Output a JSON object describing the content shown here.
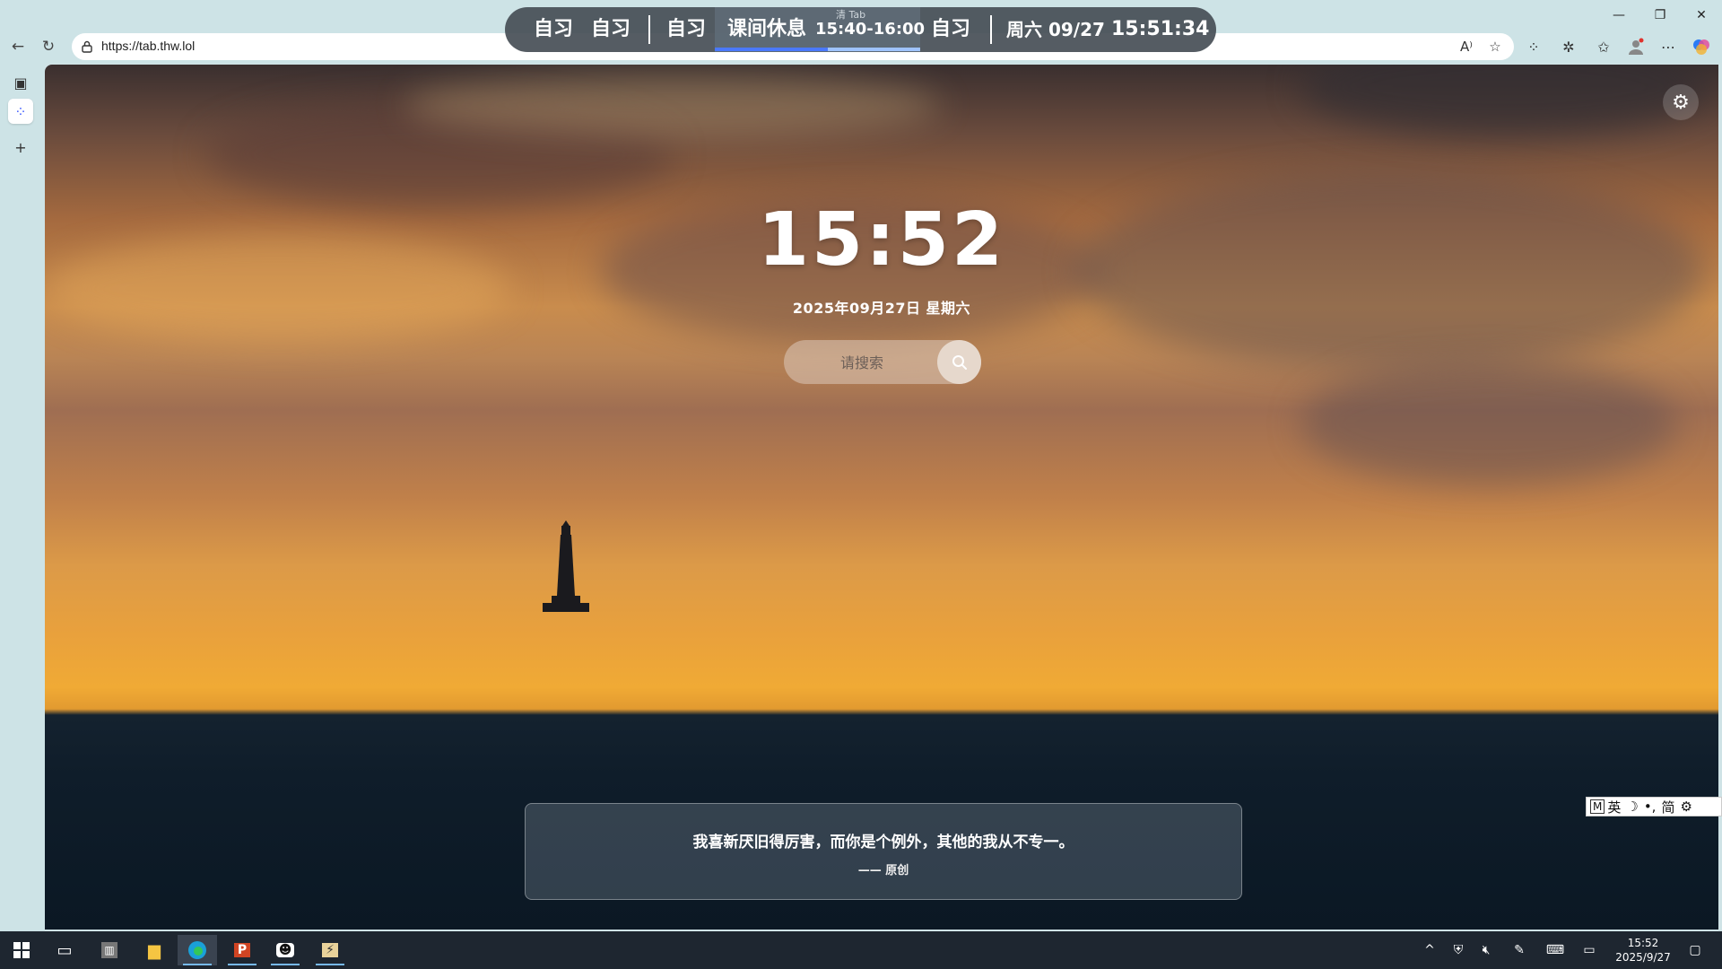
{
  "browser": {
    "url": "https://tab.thw.lol",
    "tab_ghost_title": "清 Tab",
    "window_controls": {
      "minimize": "—",
      "restore": "❐",
      "close": "✕"
    }
  },
  "schedule_bar": {
    "items": [
      "自习",
      "自习",
      "自习"
    ],
    "current_label": "课间休息",
    "current_time": "15:40-16:00",
    "next_label": "自习",
    "day": "周六 09/27",
    "clock": "15:51:34"
  },
  "page": {
    "clock": "15:52",
    "date": "2025年09月27日 星期六",
    "search_placeholder": "请搜索",
    "quote": "我喜新厌旧得厉害，而你是个例外，其他的我从不专一。",
    "quote_source": "—— 原创"
  },
  "ime": {
    "mode": "M",
    "lang": "英",
    "punct": "•,",
    "charset": "简"
  },
  "taskbar": {
    "time": "15:52",
    "date": "2025/9/27",
    "accent_color": "#76b9ed"
  },
  "colors": {
    "schedule_bg": "#464e56",
    "schedule_highlight": "#4a79ff",
    "chrome_bg": "#cde3e6",
    "taskbar_bg": "#1e2630"
  }
}
